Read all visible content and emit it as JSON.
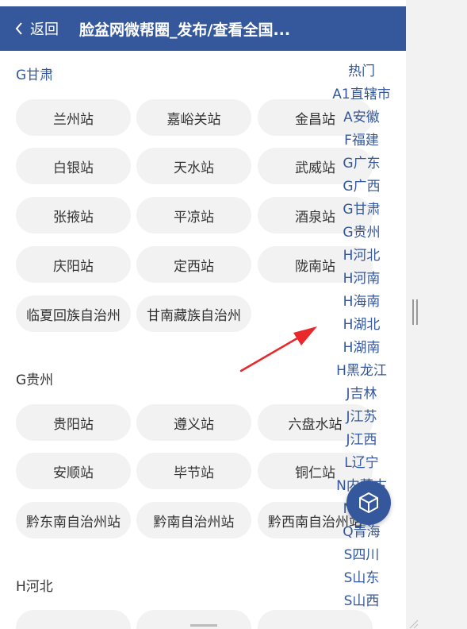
{
  "header": {
    "back_label": "返回",
    "title": "脸盆网微帮圈_发布/查看全国..."
  },
  "sections": {
    "gansu": {
      "title": "G甘肃",
      "items": [
        "兰州站",
        "嘉峪关站",
        "金昌站",
        "白银站",
        "天水站",
        "武威站",
        "张掖站",
        "平凉站",
        "酒泉站",
        "庆阳站",
        "定西站",
        "陇南站",
        "临夏回族自治州",
        "甘南藏族自治州"
      ]
    },
    "guizhou": {
      "title": "G贵州",
      "items": [
        "贵阳站",
        "遵义站",
        "六盘水站",
        "安顺站",
        "毕节站",
        "铜仁站",
        "黔东南自治州站",
        "黔南自治州站",
        "黔西南自治州站"
      ]
    },
    "hebei": {
      "title": "H河北"
    }
  },
  "index": [
    "热门",
    "A1直辖市",
    "A安徽",
    "F福建",
    "G广东",
    "G广西",
    "G甘肃",
    "G贵州",
    "H河北",
    "H河南",
    "H海南",
    "H湖北",
    "H湖南",
    "H黑龙江",
    "J吉林",
    "J江苏",
    "J江西",
    "L辽宁",
    "N内蒙古",
    "N宁夏",
    "Q青海",
    "S四川",
    "S山东",
    "S山西"
  ],
  "colors": {
    "primary": "#35589c",
    "annotation_arrow": "#e8282b",
    "pill_bg": "#f2f2f2"
  },
  "icons": {
    "back": "chevron-left-icon",
    "fab": "cube-icon"
  }
}
